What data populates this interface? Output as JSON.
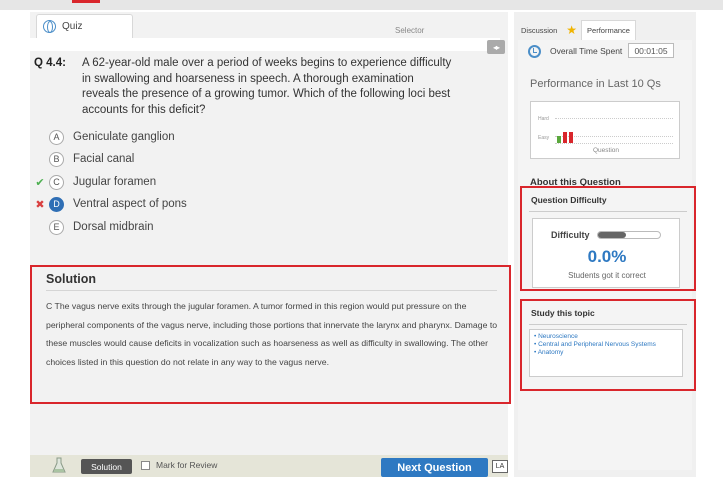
{
  "quiz": {
    "tab_label": "Quiz",
    "selector_label": "Selector",
    "collapse_label": "◂▸",
    "question": {
      "number": "Q 4.4:",
      "text": "A 62-year-old male over a period of weeks begins to experience difficulty in swallowing and hoarseness in speech. A thorough examination reveals the presence of a growing tumor. Which of the following loci best accounts for this deficit?"
    },
    "choices": [
      {
        "letter": "A",
        "text": "Geniculate ganglion",
        "mark": "",
        "selected": false
      },
      {
        "letter": "B",
        "text": "Facial canal",
        "mark": "",
        "selected": false
      },
      {
        "letter": "C",
        "text": "Jugular foramen",
        "mark": "✔",
        "selected": false
      },
      {
        "letter": "D",
        "text": "Ventral aspect of pons",
        "mark": "✖",
        "selected": true
      },
      {
        "letter": "E",
        "text": "Dorsal midbrain",
        "mark": "",
        "selected": false
      }
    ],
    "solution": {
      "title": "Solution",
      "text": "C The vagus nerve exits through the jugular foramen. A tumor formed in this region would put pressure on the peripheral components of the vagus nerve, including those portions that innervate the larynx and pharynx. Damage to these muscles would cause deficits in vocalization such as hoarseness as well as difficulty in swallowing. The other choices listed in this question do not relate in any way to the vagus nerve."
    }
  },
  "bottom_bar": {
    "solution_button": "Solution",
    "mark_review_label": "Mark for Review",
    "next_button": "Next Question",
    "lab_icon": "LA"
  },
  "sidebar": {
    "tabs": [
      {
        "label": "Discussion",
        "active": false
      },
      {
        "label": "★",
        "active": false
      },
      {
        "label": "Performance",
        "active": true
      }
    ],
    "overall_time_label": "Overall Time Spent",
    "overall_time_value": "00:01:05",
    "performance_title": "Performance in Last 10 Qs",
    "performance_chart": {
      "hard_label": "Hard",
      "easy_label": "Easy",
      "x_label": "Question",
      "bars": [
        {
          "color": "#5aa83c",
          "level": 0.35
        },
        {
          "color": "#d9262c",
          "level": 0.55
        },
        {
          "color": "#d9262c",
          "level": 0.55
        }
      ]
    },
    "about_title": "About this Question",
    "difficulty": {
      "heading": "Question Difficulty",
      "label": "Difficulty",
      "level": 0.45,
      "percent": "0.0%",
      "sub": "Students got it correct"
    },
    "study": {
      "heading": "Study this topic",
      "topics": [
        "• Neuroscience",
        "• Central and Peripheral Nervous Systems",
        "• Anatomy"
      ]
    }
  }
}
